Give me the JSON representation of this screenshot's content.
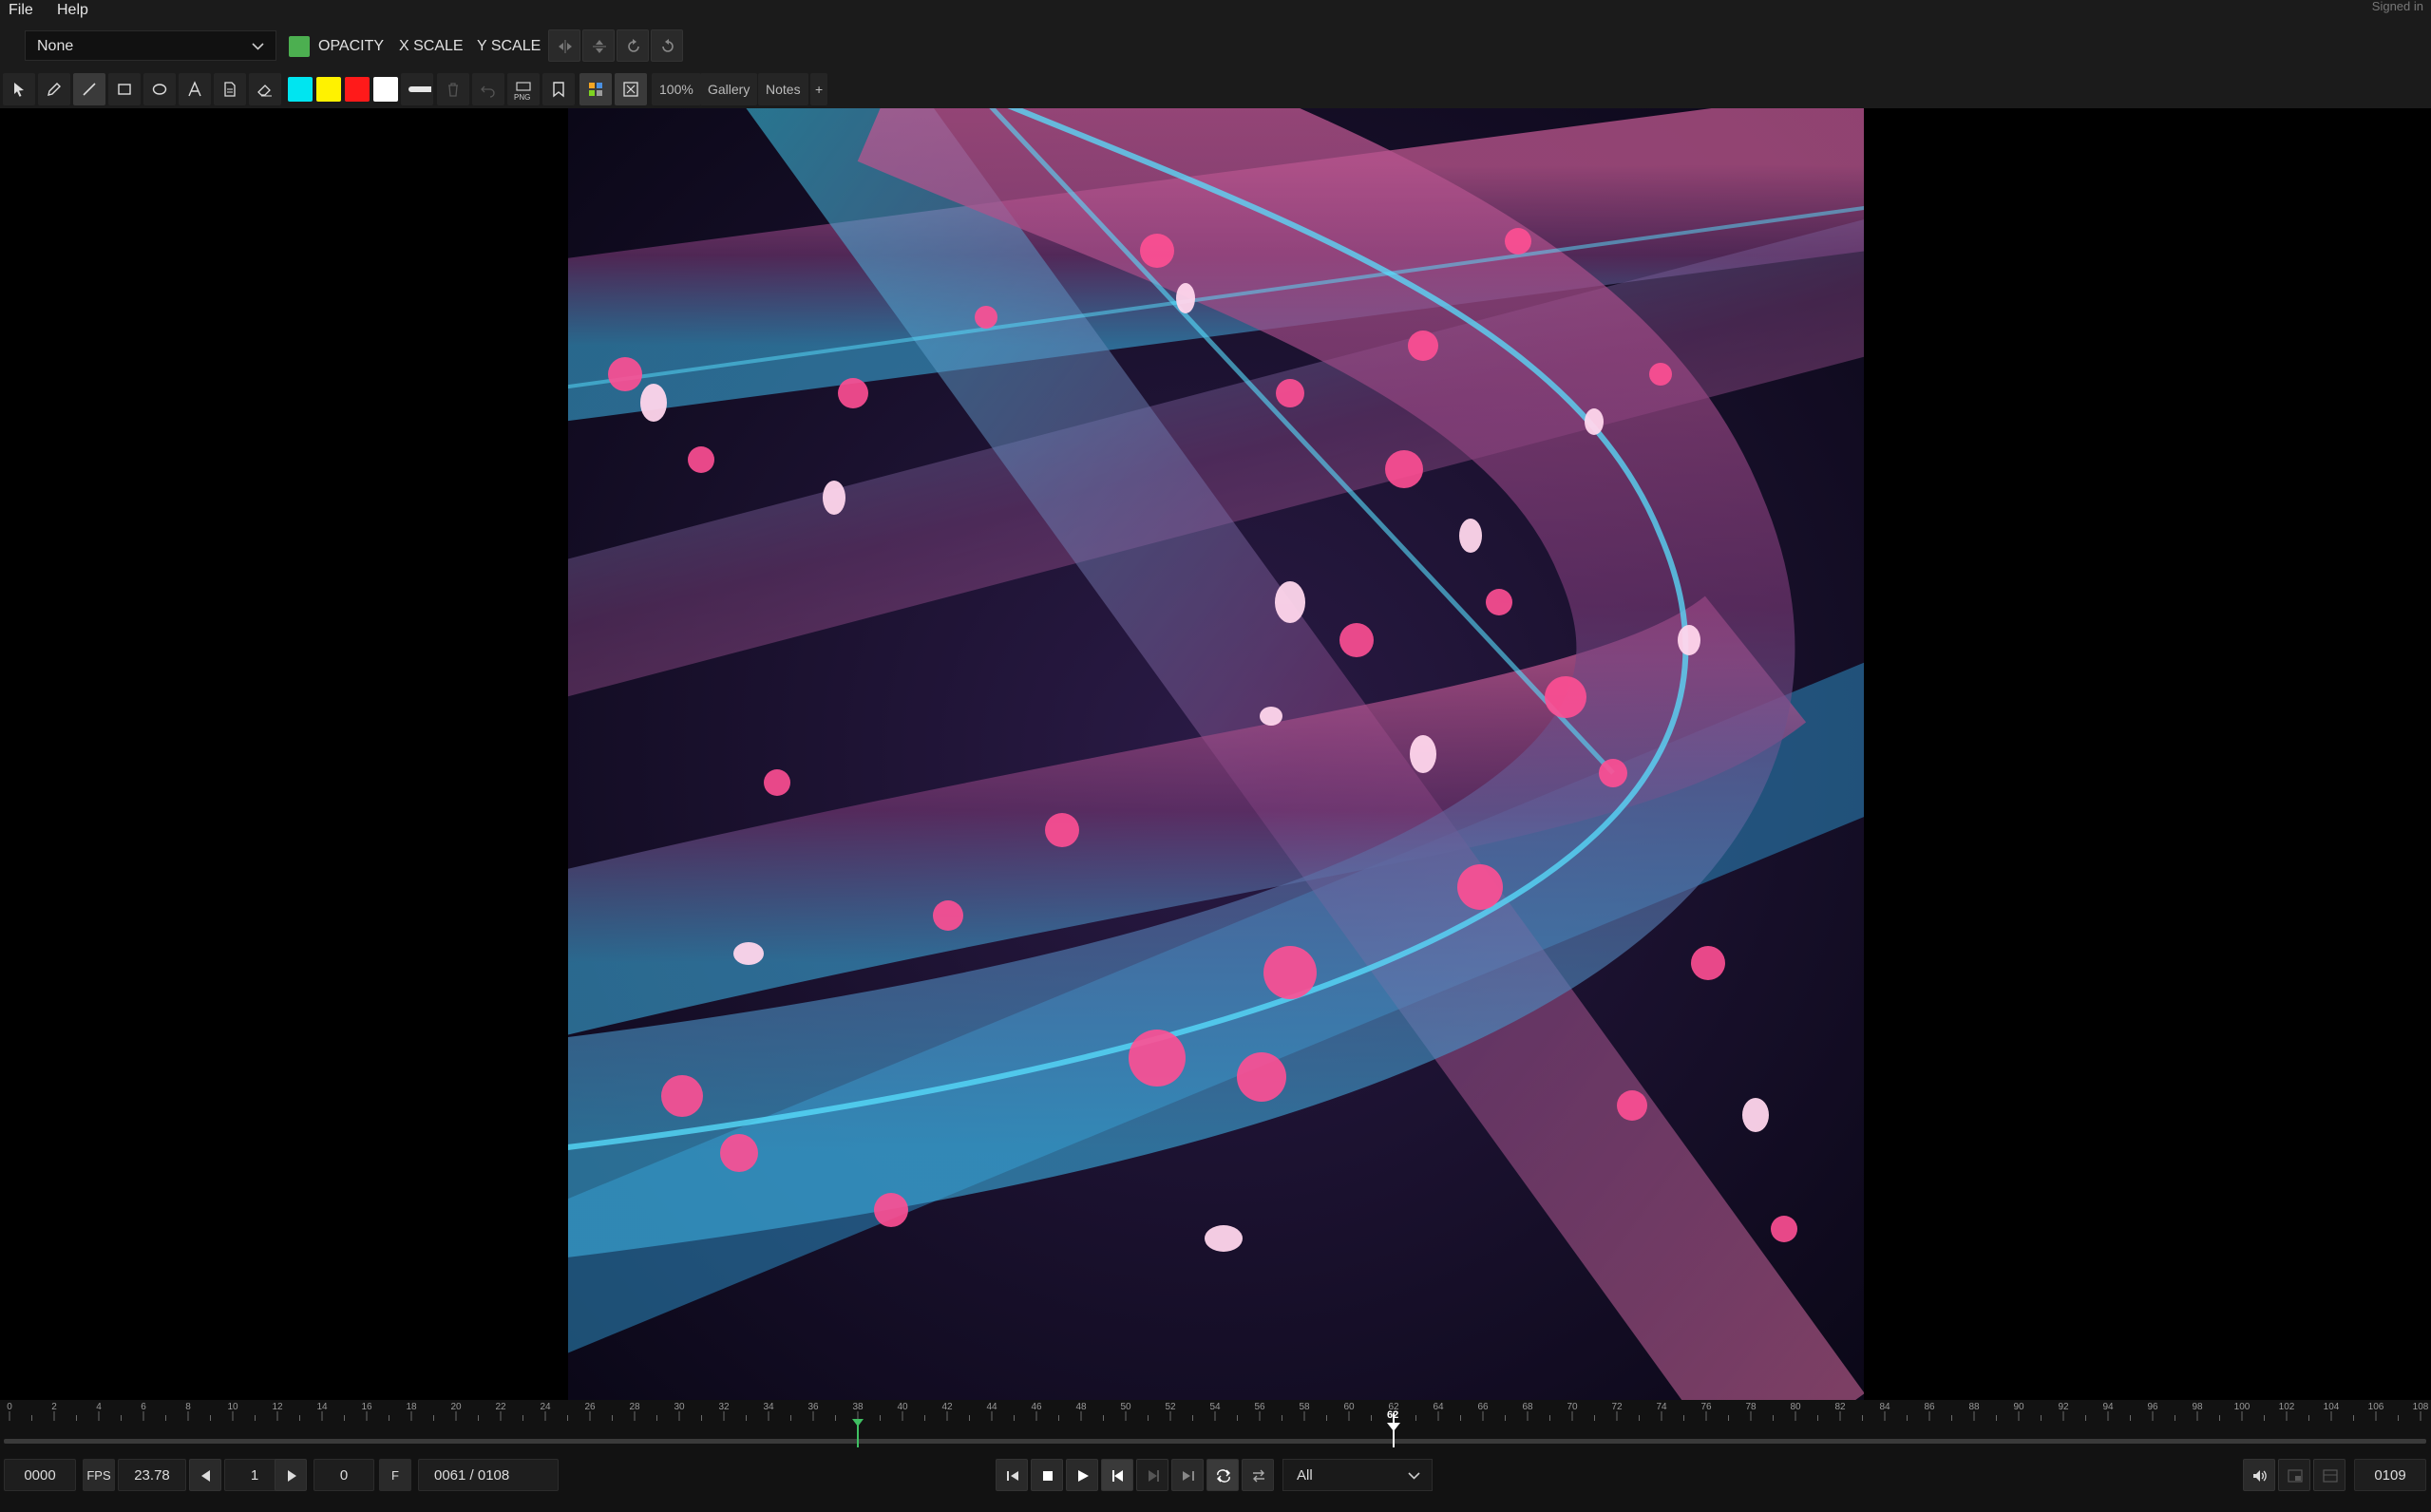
{
  "menubar": {
    "items": [
      "File",
      "Help"
    ],
    "status": "Signed in"
  },
  "toolbar": {
    "layer_select": {
      "value": "None"
    },
    "swatch_color": "#4caf50",
    "labels": {
      "opacity": "OPACITY",
      "x_scale": "X SCALE",
      "y_scale": "Y SCALE"
    },
    "transform_icons": [
      "flip-horizontal-icon",
      "flip-vertical-icon",
      "rotate-icon",
      "reset-icon"
    ]
  },
  "draw_toolbar": {
    "tools": [
      "pointer-icon",
      "pencil-icon",
      "line-icon",
      "rectangle-icon",
      "ellipse-icon",
      "text-icon",
      "note-icon",
      "eraser-icon"
    ],
    "colors": [
      "#00e5f0",
      "#fff200",
      "#ff1a1a",
      "#ffffff"
    ],
    "zoom": "100%",
    "gallery": "Gallery",
    "notes": "Notes",
    "more": "+",
    "export_label": "PNG"
  },
  "timeline": {
    "tick_labels": [
      "0",
      "2",
      "4",
      "6",
      "8",
      "10",
      "12",
      "14",
      "16",
      "18",
      "20",
      "22",
      "24",
      "26",
      "28",
      "30",
      "32",
      "34",
      "36",
      "38",
      "40",
      "42",
      "44",
      "46",
      "48",
      "50",
      "52",
      "54",
      "56",
      "58",
      "60",
      "62",
      "64",
      "66",
      "68",
      "70",
      "72",
      "74",
      "76",
      "78",
      "80",
      "82",
      "84",
      "86",
      "88",
      "90",
      "92",
      "94",
      "96",
      "98",
      "100",
      "102",
      "104",
      "106",
      "108"
    ],
    "playhead_label": "62",
    "total_frames": 108,
    "in_point": 38,
    "playhead": 62
  },
  "playback": {
    "start_frame": "0000",
    "fps_label": "FPS",
    "fps_value": "23.78",
    "step_value": "1",
    "offset_value": "0",
    "f_label": "F",
    "frame_counter": "0061 / 0108",
    "range": "All",
    "end_frame": "0109"
  }
}
